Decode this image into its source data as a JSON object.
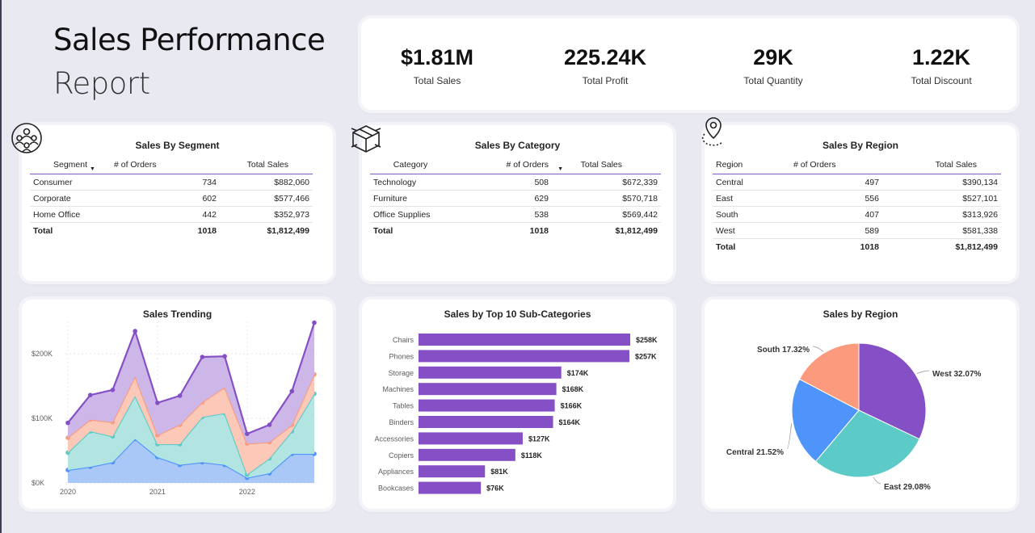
{
  "report": {
    "title_line1": "Sales Performance",
    "title_line2": "Report"
  },
  "kpis": [
    {
      "value": "$1.81M",
      "label": "Total Sales"
    },
    {
      "value": "225.24K",
      "label": "Total Profit"
    },
    {
      "value": "29K",
      "label": "Total Quantity"
    },
    {
      "value": "1.22K",
      "label": "Total Discount"
    }
  ],
  "segment_table": {
    "title": "Sales By Segment",
    "headers": [
      "Segment",
      "# of Orders",
      "Total Sales"
    ],
    "rows": [
      [
        "Consumer",
        "734",
        "$882,060"
      ],
      [
        "Corporate",
        "602",
        "$577,466"
      ],
      [
        "Home Office",
        "442",
        "$352,973"
      ]
    ],
    "total": [
      "Total",
      "1018",
      "$1,812,499"
    ]
  },
  "category_table": {
    "title": "Sales By Category",
    "headers": [
      "Category",
      "# of Orders",
      "Total Sales"
    ],
    "rows": [
      [
        "Technology",
        "508",
        "$672,339"
      ],
      [
        "Furniture",
        "629",
        "$570,718"
      ],
      [
        "Office Supplies",
        "538",
        "$569,442"
      ]
    ],
    "total": [
      "Total",
      "1018",
      "$1,812,499"
    ]
  },
  "region_table": {
    "title": "Sales By Region",
    "headers": [
      "Region",
      "# of Orders",
      "Total Sales"
    ],
    "rows": [
      [
        "Central",
        "497",
        "$390,134"
      ],
      [
        "East",
        "556",
        "$527,101"
      ],
      [
        "South",
        "407",
        "$313,926"
      ],
      [
        "West",
        "589",
        "$581,338"
      ]
    ],
    "total": [
      "Total",
      "1018",
      "$1,812,499"
    ]
  },
  "charts": {
    "trend_title": "Sales Trending",
    "subcat_title": "Sales by Top 10 Sub-Categories",
    "region_title": "Sales by Region"
  },
  "colors": {
    "purple": "#8550c5",
    "salmon": "#fb9a7d",
    "teal": "#5ccac6",
    "blue": "#4e94fa"
  },
  "chart_data": [
    {
      "type": "area",
      "title": "Sales Trending",
      "x": [
        "2020-01",
        "2020-04",
        "2020-07",
        "2020-10",
        "2021-01",
        "2021-04",
        "2021-07",
        "2021-10",
        "2022-01",
        "2022-04",
        "2022-07",
        "2022-10"
      ],
      "x_tick_labels": [
        "2020",
        "2021",
        "2022"
      ],
      "y_tick_labels": [
        "$0K",
        "$100K",
        "$200K"
      ],
      "ylim": [
        0,
        250000
      ],
      "stacked": true,
      "grid": true,
      "series": [
        {
          "values": [
            20000,
            25000,
            32000,
            68000,
            40000,
            28000,
            32000,
            28000,
            8000,
            15000,
            45000,
            45000
          ]
        },
        {
          "values": [
            27000,
            55000,
            40000,
            67000,
            20000,
            32000,
            70000,
            80000,
            5000,
            23000,
            35000,
            93000
          ]
        },
        {
          "values": [
            23000,
            18000,
            22000,
            30000,
            14000,
            30000,
            23000,
            40000,
            48000,
            25000,
            10000,
            30000
          ]
        },
        {
          "values": [
            23000,
            38000,
            50000,
            70000,
            50000,
            45000,
            70000,
            48000,
            15000,
            27000,
            52000,
            80000
          ]
        }
      ]
    },
    {
      "type": "bar",
      "orientation": "horizontal",
      "title": "Sales by Top 10 Sub-Categories",
      "categories": [
        "Chairs",
        "Phones",
        "Storage",
        "Machines",
        "Tables",
        "Binders",
        "Accessories",
        "Copiers",
        "Appliances",
        "Bookcases"
      ],
      "values": [
        258,
        257,
        174,
        168,
        166,
        164,
        127,
        118,
        81,
        76
      ],
      "data_labels": [
        "$258K",
        "$257K",
        "$174K",
        "$168K",
        "$166K",
        "$164K",
        "$127K",
        "$118K",
        "$81K",
        "$76K"
      ]
    },
    {
      "type": "pie",
      "title": "Sales by Region",
      "categories": [
        "West",
        "East",
        "Central",
        "South"
      ],
      "values": [
        32.07,
        29.08,
        21.52,
        17.32
      ],
      "labels": [
        "West 32.07%",
        "East 29.08%",
        "Central 21.52%",
        "South 17.32%"
      ],
      "colors": [
        "#8550c5",
        "#5ccac6",
        "#4e94fa",
        "#fb9a7d"
      ]
    }
  ]
}
